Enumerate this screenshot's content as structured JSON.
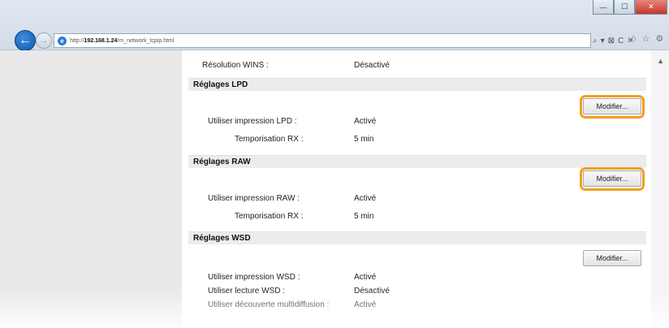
{
  "browser": {
    "address": {
      "scheme": "http://",
      "host": "192.168.1.24",
      "path": "/m_network_tcpip.html"
    },
    "addr_tools": [
      "⌕",
      "▾",
      "⊠",
      "C",
      "✕"
    ],
    "toolbar_icons": [
      "⌂",
      "☆",
      "⚙"
    ],
    "window_controls": [
      "—",
      "☐",
      "✕"
    ]
  },
  "page": {
    "top_row": {
      "label": "Résolution WINS :",
      "value": "Désactivé"
    },
    "sections": [
      {
        "title": "Réglages LPD",
        "button": "Modifier...",
        "highlighted": true,
        "rows": [
          {
            "label": "Utiliser impression LPD :",
            "value": "Activé"
          },
          {
            "label": "Temporisation RX :",
            "value": "5 min"
          }
        ]
      },
      {
        "title": "Réglages RAW",
        "button": "Modifier...",
        "highlighted": true,
        "rows": [
          {
            "label": "Utiliser impression RAW :",
            "value": "Activé"
          },
          {
            "label": "Temporisation RX :",
            "value": "5 min"
          }
        ]
      },
      {
        "title": "Réglages WSD",
        "button": "Modifier...",
        "highlighted": false,
        "rows": [
          {
            "label": "Utiliser impression WSD :",
            "value": "Activé"
          },
          {
            "label": "Utiliser lecture WSD :",
            "value": "Désactivé"
          },
          {
            "label": "Utiliser découverte multidiffusion :",
            "value": "Activé"
          }
        ]
      }
    ]
  },
  "colors": {
    "highlight": "#f0a020",
    "section_bar": "#ececec",
    "left_rail": "#e9e9e9"
  }
}
